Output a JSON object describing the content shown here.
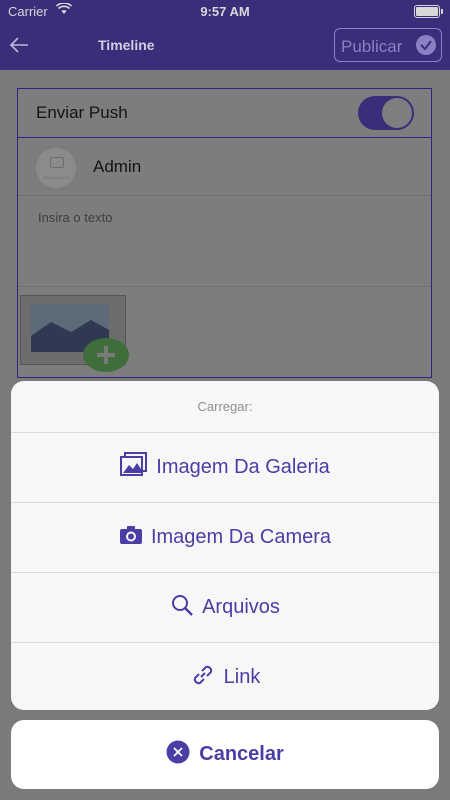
{
  "status": {
    "carrier": "Carrier",
    "time": "9:57 AM"
  },
  "nav": {
    "title": "Timeline",
    "publish": "Publicar"
  },
  "form": {
    "push_label": "Enviar Push",
    "push_enabled": true,
    "author": "Admin",
    "avatar_text": "SEM IMAGEM",
    "text_placeholder": "Insira o texto"
  },
  "sheet": {
    "title": "Carregar:",
    "actions": [
      {
        "label": "Imagem Da Galeria",
        "icon": "gallery-icon"
      },
      {
        "label": "Imagem Da Camera",
        "icon": "camera-icon"
      },
      {
        "label": "Arquivos",
        "icon": "search-icon"
      },
      {
        "label": "Link",
        "icon": "link-icon"
      }
    ],
    "cancel": "Cancelar"
  },
  "colors": {
    "accent": "#4a3ea5",
    "nav": "#3a2d7a"
  }
}
